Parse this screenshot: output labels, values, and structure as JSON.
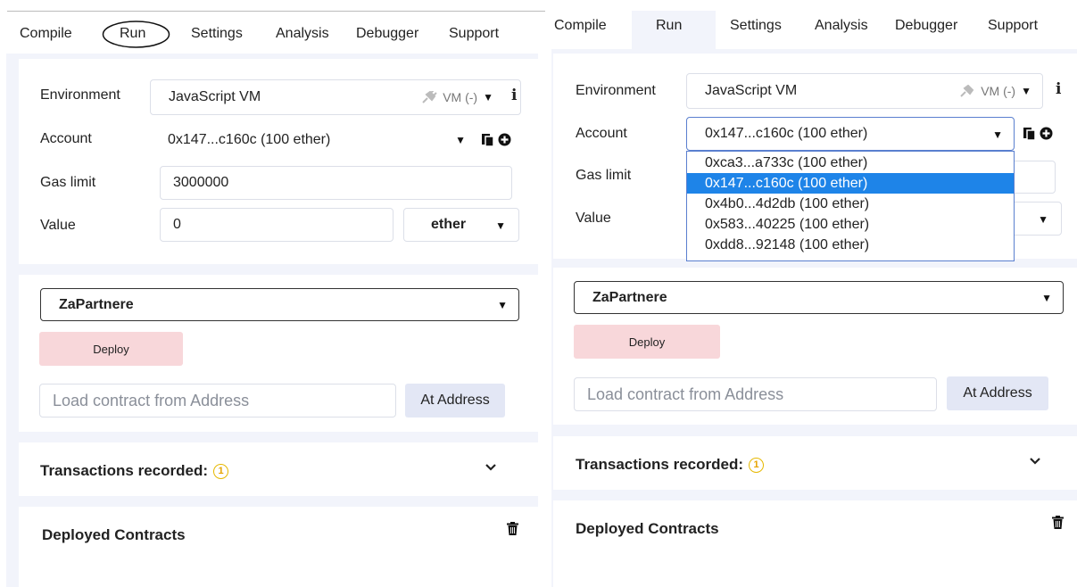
{
  "tabs": [
    "Compile",
    "Run",
    "Settings",
    "Analysis",
    "Debugger",
    "Support"
  ],
  "left": {
    "environment": {
      "label": "Environment",
      "value": "JavaScript VM",
      "vm": "VM (-)"
    },
    "account": {
      "label": "Account",
      "value": "0x147...c160c (100 ether)"
    },
    "gas_limit": {
      "label": "Gas limit",
      "value": "3000000"
    },
    "value": {
      "label": "Value",
      "amount": "0",
      "unit": "ether"
    },
    "contract": "ZaPartnere",
    "deploy": "Deploy",
    "load_placeholder": "Load contract from Address",
    "at_address": "At Address",
    "transactions": {
      "label": "Transactions recorded:",
      "count": "1"
    },
    "deployed": "Deployed Contracts"
  },
  "right": {
    "environment": {
      "label": "Environment",
      "value": "JavaScript VM",
      "vm": "VM (-)"
    },
    "account": {
      "label": "Account",
      "value": "0x147...c160c (100 ether)"
    },
    "gas_limit": {
      "label": "Gas limit"
    },
    "value": {
      "label": "Value"
    },
    "account_options": [
      "0xca3...a733c (100 ether)",
      "0x147...c160c (100 ether)",
      "0x4b0...4d2db (100 ether)",
      "0x583...40225 (100 ether)",
      "0xdd8...92148 (100 ether)"
    ],
    "selected_index": 1,
    "contract": "ZaPartnere",
    "deploy": "Deploy",
    "load_placeholder": "Load contract from Address",
    "at_address": "At Address",
    "transactions": {
      "label": "Transactions recorded:",
      "count": "1"
    },
    "deployed": "Deployed Contracts"
  },
  "colors": {
    "accent": "#1e84e8",
    "deploy_bg": "#f8d7da",
    "badge": "#e6b800"
  }
}
